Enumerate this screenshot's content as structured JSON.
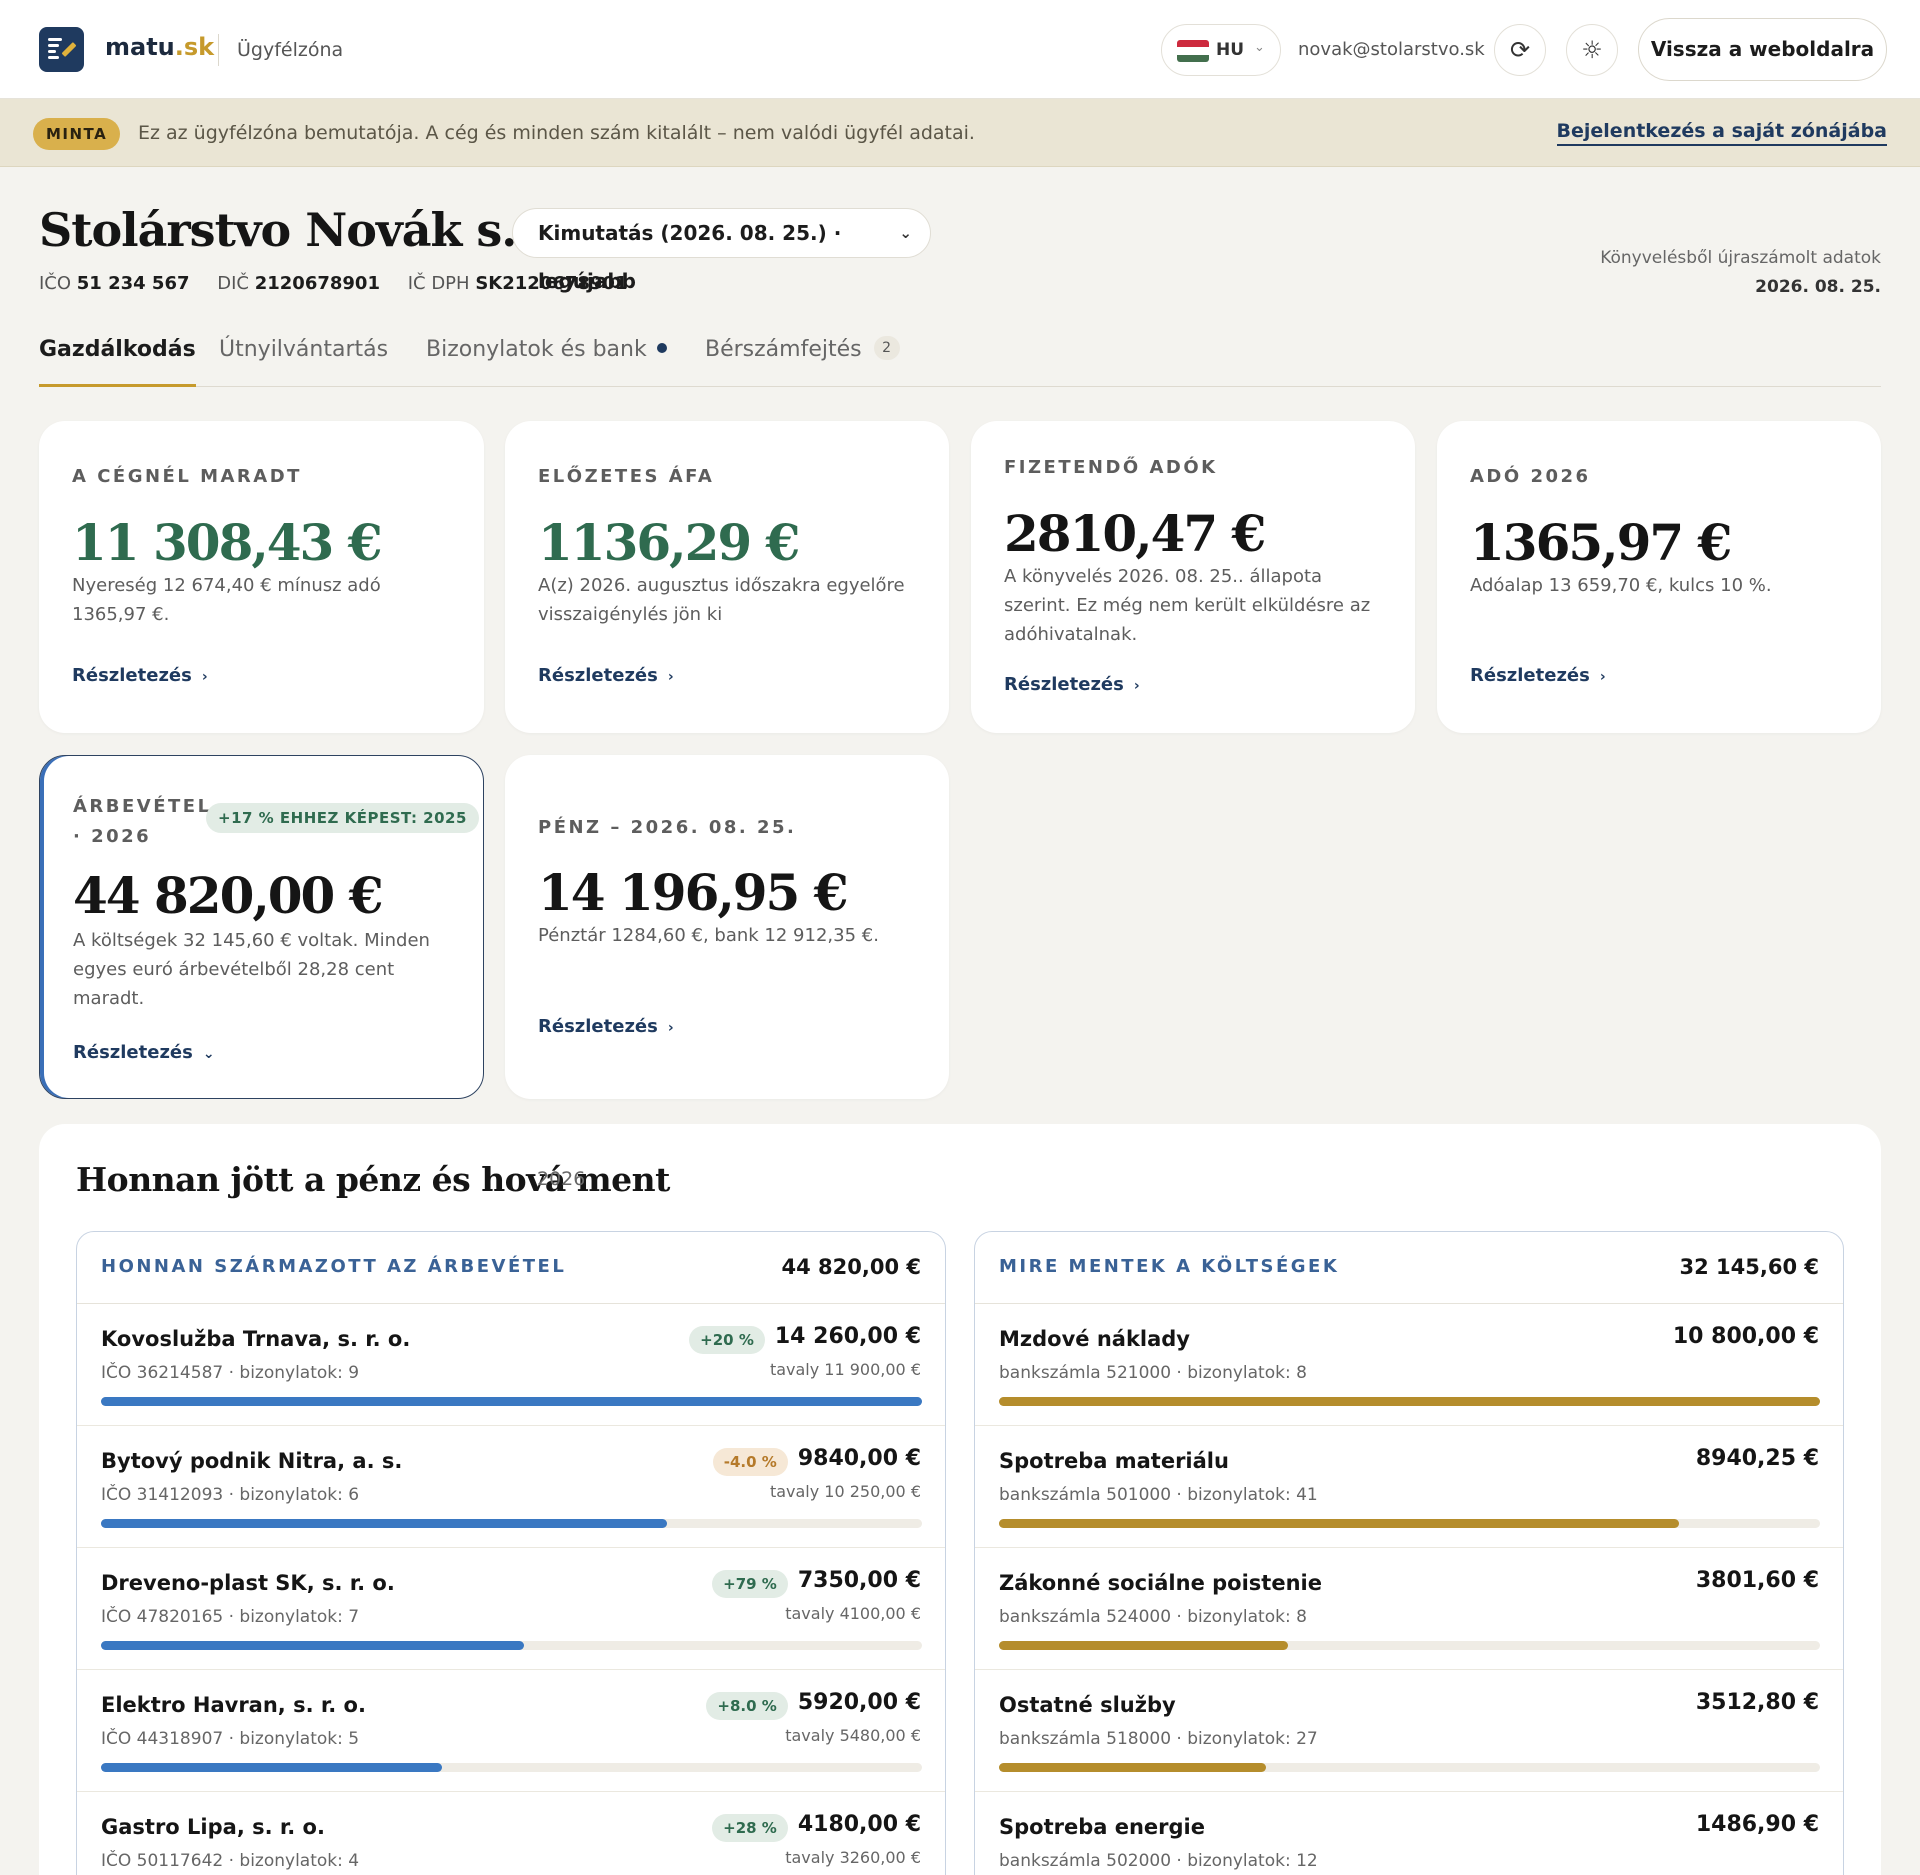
{
  "header": {
    "brand_main": "matu",
    "brand_accent": ".sk",
    "zone": "Ügyfélzóna",
    "lang": "HU",
    "email": "novak@stolarstvo.sk",
    "back_label": "Vissza a weboldalra"
  },
  "banner": {
    "badge": "MINTA",
    "text": "Ez az ügyfélzóna bemutatója. A cég és minden szám kitalált – nem valódi ügyfél adatai.",
    "link": "Bejelentkezés a saját zónájába"
  },
  "company": {
    "name": "Stolárstvo Novák s. r. o.",
    "report": "Kimutatás (2026. 08. 25.) · legújabb",
    "ico_label": "IČO",
    "ico": "51 234 567",
    "dic_label": "DIČ",
    "dic": "2120678901",
    "icdph_label": "IČ DPH",
    "icdph": "SK2120678901",
    "recalc_text": "Könyvelésből újraszámolt adatok",
    "recalc_date": "2026. 08. 25."
  },
  "tabs": [
    {
      "label": "Gazdálkodás"
    },
    {
      "label": "Útnyilvántartás"
    },
    {
      "label": "Bizonylatok és bank"
    },
    {
      "label": "Bérszámfejtés",
      "badge": "2"
    }
  ],
  "cards": [
    {
      "label": "A CÉGNÉL MARADT",
      "value": "11 308,43 €",
      "desc": "Nyereség 12 674,40 € mínusz adó 1365,97 €.",
      "link": "Részletezés"
    },
    {
      "label": "ELŐZETES ÁFA",
      "value": "1136,29 €",
      "desc": "A(z) 2026. augusztus időszakra egyelőre visszaigénylés jön ki",
      "link": "Részletezés"
    },
    {
      "label": "FIZETENDŐ ADÓK",
      "value": "2810,47 €",
      "desc": "A könyvelés 2026. 08. 25.. állapota szerint. Ez még nem került elküldésre az adóhivatalnak.",
      "link": "Részletezés"
    },
    {
      "label": "ADÓ 2026",
      "value": "1365,97 €",
      "desc": "Adóalap 13 659,70 €, kulcs 10 %.",
      "link": "Részletezés"
    },
    {
      "label_line1": "ÁRBEVÉTEL",
      "label_line2": "· 2026",
      "badge": "+17 % EHHEZ KÉPEST: 2025",
      "value": "44 820,00 €",
      "desc": "A költségek 32 145,60 € voltak. Minden egyes euró árbevételből 28,28 cent maradt.",
      "link": "Részletezés"
    },
    {
      "label": "PÉNZ – 2026. 08. 25.",
      "value": "14 196,95 €",
      "desc": "Pénztár 1284,60 €, bank 12 912,35 €.",
      "link": "Részletezés"
    }
  ],
  "flow": {
    "title": "Honnan jött a pénz és hová ment",
    "year": "2026",
    "income": {
      "title": "HONNAN SZÁRMAZOTT AZ ÁRBEVÉTEL",
      "total": "44 820,00 €",
      "rows": [
        {
          "name": "Kovoslužba Trnava, s. r. o.",
          "sub": "IČO 36214587 · bizonylatok: 9",
          "change": "+20 %",
          "dir": "up",
          "amount": "14 260,00 €",
          "prev": "tavaly 11 900,00 €",
          "share": 1.0
        },
        {
          "name": "Bytový podnik Nitra, a. s.",
          "sub": "IČO 31412093 · bizonylatok: 6",
          "change": "-4.0 %",
          "dir": "down",
          "amount": "9840,00 €",
          "prev": "tavaly 10 250,00 €",
          "share": 0.69
        },
        {
          "name": "Dreveno-plast SK, s. r. o.",
          "sub": "IČO 47820165 · bizonylatok: 7",
          "change": "+79 %",
          "dir": "up",
          "amount": "7350,00 €",
          "prev": "tavaly 4100,00 €",
          "share": 0.515
        },
        {
          "name": "Elektro Havran, s. r. o.",
          "sub": "IČO 44318907 · bizonylatok: 5",
          "change": "+8.0 %",
          "dir": "up",
          "amount": "5920,00 €",
          "prev": "tavaly 5480,00 €",
          "share": 0.415
        },
        {
          "name": "Gastro Lipa, s. r. o.",
          "sub": "IČO 50117642 · bizonylatok: 4",
          "change": "+28 %",
          "dir": "up",
          "amount": "4180,00 €",
          "prev": "tavaly 3260,00 €",
          "share": 0.293
        }
      ]
    },
    "expenses": {
      "title": "MIRE MENTEK A KÖLTSÉGEK",
      "total": "32 145,60 €",
      "rows": [
        {
          "name": "Mzdové náklady",
          "sub": "bankszámla 521000 · bizonylatok: 8",
          "amount": "10 800,00 €",
          "share": 1.0
        },
        {
          "name": "Spotreba materiálu",
          "sub": "bankszámla 501000 · bizonylatok: 41",
          "amount": "8940,25 €",
          "share": 0.828
        },
        {
          "name": "Zákonné sociálne poistenie",
          "sub": "bankszámla 524000 · bizonylatok: 8",
          "amount": "3801,60 €",
          "share": 0.352
        },
        {
          "name": "Ostatné služby",
          "sub": "bankszámla 518000 · bizonylatok: 27",
          "amount": "3512,80 €",
          "share": 0.325
        },
        {
          "name": "Spotreba energie",
          "sub": "bankszámla 502000 · bizonylatok: 12",
          "amount": "1486,90 €",
          "share": 0.138
        }
      ]
    }
  },
  "colors": {
    "accent_gold": "#c69a2c",
    "brand_navy": "#1f3a5f",
    "positive_green": "#2f6b4f",
    "income_bar": "#3a78c2",
    "expense_bar": "#b58d2c"
  }
}
